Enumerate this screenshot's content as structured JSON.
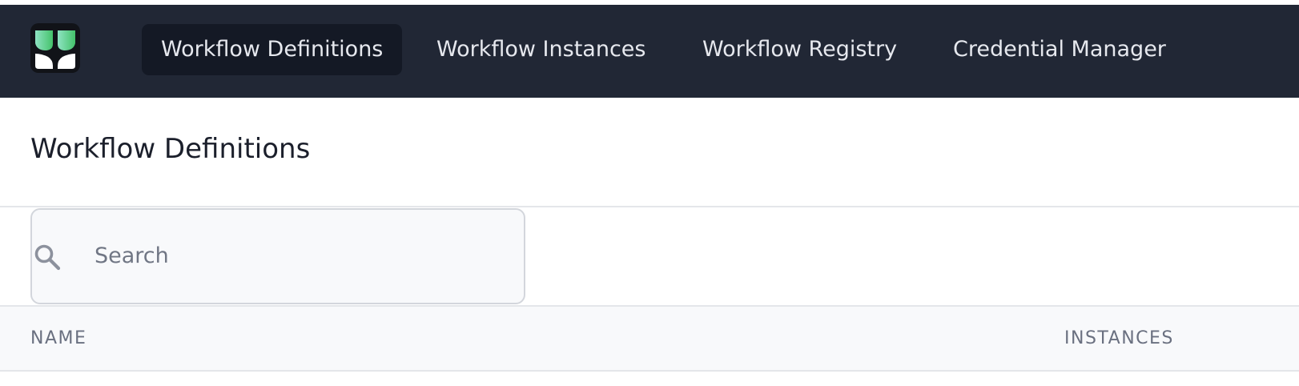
{
  "topbar": {
    "logo_icon": "app-logo-icon",
    "nav_items": [
      {
        "label": "Workflow Definitions",
        "active": true
      },
      {
        "label": "Workflow Instances",
        "active": false
      },
      {
        "label": "Workflow Registry",
        "active": false
      },
      {
        "label": "Credential Manager",
        "active": false
      }
    ]
  },
  "main": {
    "title": "Workflow Definitions",
    "search": {
      "icon": "search-icon",
      "placeholder": "Search",
      "value": ""
    },
    "table": {
      "columns": [
        "NAME",
        "INSTANCES"
      ],
      "rows": []
    }
  },
  "colors": {
    "topbar_bg": "#212735",
    "active_nav_bg": "#141925",
    "logo_green_light": "#7fdcb0",
    "logo_green": "#4cc46f"
  }
}
